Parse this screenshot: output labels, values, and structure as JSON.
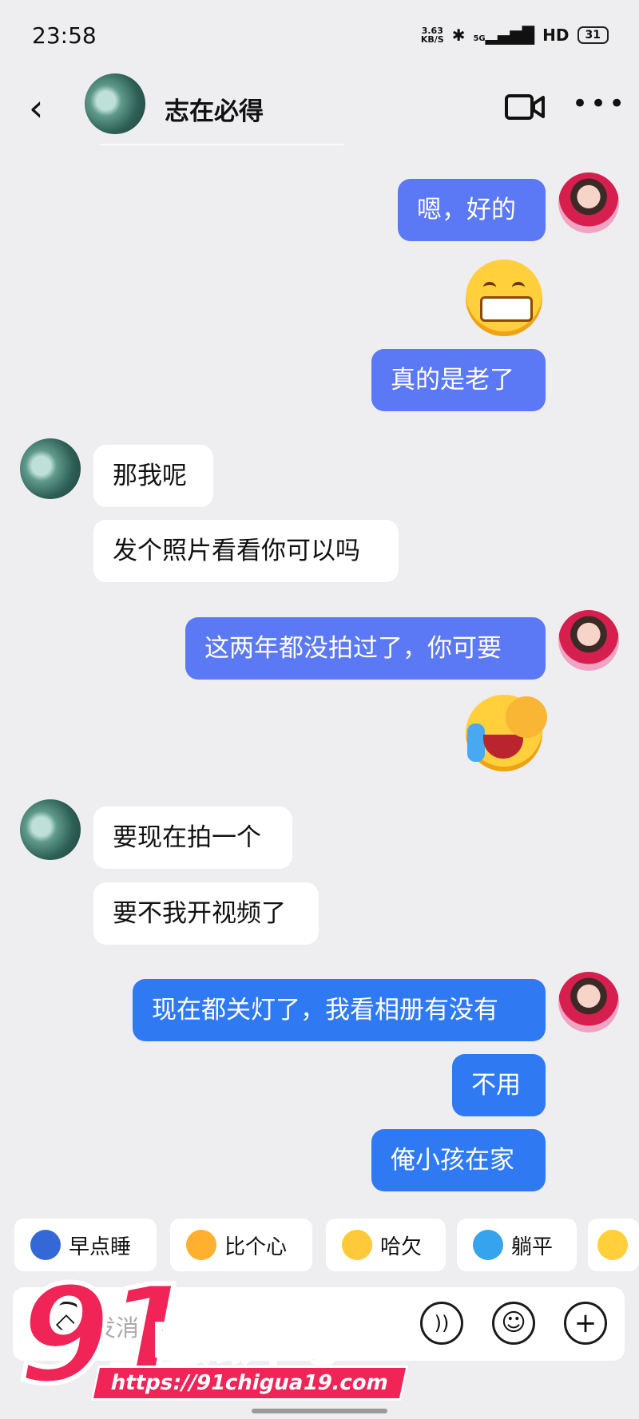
{
  "status_bar": {
    "time": "23:58",
    "net_speed_top": "3.63",
    "net_speed_unit": "KB/S",
    "signal": "5G",
    "hd": "HD",
    "battery": "31"
  },
  "header": {
    "back_symbol": "‹",
    "title": "志在必得",
    "video_icon": "video-camera-icon",
    "more_symbol": "•••"
  },
  "messages": [
    {
      "side": "out",
      "text": "嗯，好的"
    },
    {
      "side": "out",
      "emoji": "grinning-face"
    },
    {
      "side": "out",
      "text": "真的是老了"
    },
    {
      "side": "in",
      "text": "那我呢"
    },
    {
      "side": "in",
      "text": "发个照片看看你可以吗"
    },
    {
      "side": "out",
      "text": "这两年都没拍过了，你可要"
    },
    {
      "side": "out",
      "emoji": "facepalm-crying-face"
    },
    {
      "side": "in",
      "text": "要现在拍一个"
    },
    {
      "side": "in",
      "text": "要不我开视频了"
    },
    {
      "side": "out",
      "text": "现在都关灯了，我看相册有没有"
    },
    {
      "side": "out",
      "text": "不用"
    },
    {
      "side": "out",
      "text": "俺小孩在家"
    }
  ],
  "suggestions": [
    {
      "label": "早点睡",
      "icon": "sleep-icon"
    },
    {
      "label": "比个心",
      "icon": "heart-gesture-icon"
    },
    {
      "label": "哈欠",
      "icon": "yawn-icon"
    },
    {
      "label": "躺平",
      "icon": "lie-flat-icon"
    }
  ],
  "input": {
    "placeholder": "发消息"
  },
  "watermark": {
    "number": "91",
    "text": "吃瓜中心",
    "url": "https://91chigua19.com"
  }
}
